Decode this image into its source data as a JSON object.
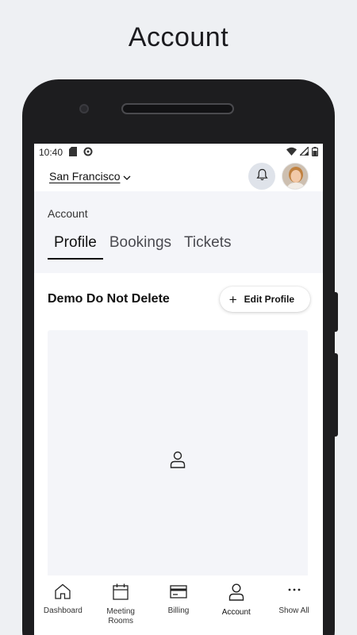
{
  "promo": {
    "title": "Account"
  },
  "status_bar": {
    "time": "10:40"
  },
  "header": {
    "location": "San Francisco"
  },
  "account": {
    "breadcrumb": "Account",
    "tabs": [
      {
        "label": "Profile",
        "active": true
      },
      {
        "label": "Bookings",
        "active": false
      },
      {
        "label": "Tickets",
        "active": false
      }
    ]
  },
  "profile": {
    "name": "Demo Do Not Delete",
    "edit_label": "Edit Profile"
  },
  "bottom_nav": {
    "items": [
      {
        "label": "Dashboard",
        "icon": "home-icon"
      },
      {
        "label": "Meeting Rooms",
        "icon": "calendar-icon"
      },
      {
        "label": "Billing",
        "icon": "credit-card-icon"
      },
      {
        "label": "Account",
        "icon": "person-icon",
        "active": true
      },
      {
        "label": "Show All",
        "icon": "more-dots-icon"
      }
    ]
  },
  "colors": {
    "background": "#eef0f3",
    "header_bg": "#f4f5f9",
    "bell_bg": "#dfe3ea"
  }
}
